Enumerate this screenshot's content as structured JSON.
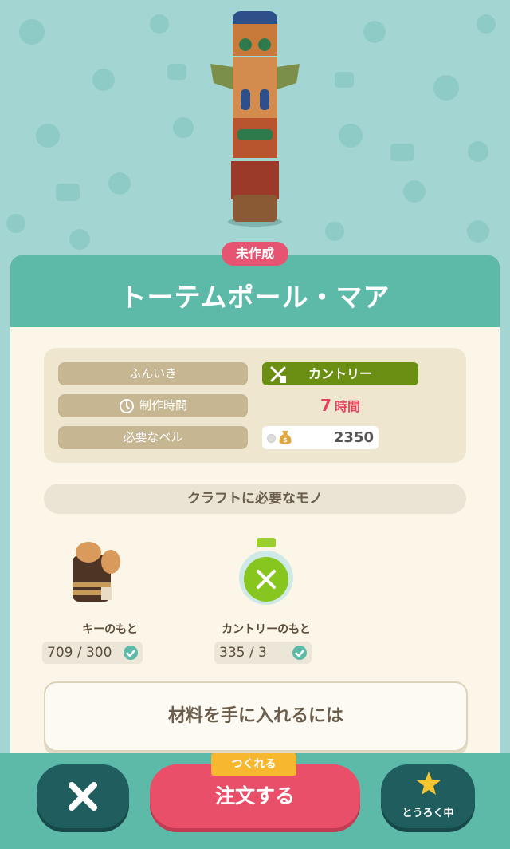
{
  "status_badge": "未作成",
  "item": {
    "name": "トーテムポール・マア"
  },
  "info": {
    "style_label": "ふんいき",
    "style_value": "カントリー",
    "time_label": "制作時間",
    "time_number": "7",
    "time_unit": "時間",
    "bells_label": "必要なベル",
    "bells_value": "2350"
  },
  "craft_header": "クラフトに必要なモノ",
  "materials": [
    {
      "name": "キーのもと",
      "count": "709 / 300",
      "icon": "wood-bundle-icon"
    },
    {
      "name": "カントリーのもと",
      "count": "335 / 3",
      "icon": "green-potion-icon"
    }
  ],
  "get_materials_label": "材料を手に入れるには",
  "actions": {
    "craftable_tag": "つくれる",
    "order_label": "注文する",
    "favorite_label": "とうろく中"
  },
  "colors": {
    "accent": "#5dbaa9",
    "cta": "#ea4f69",
    "dark_button": "#1f5d5e",
    "badge": "#e55471",
    "style_green": "#6b8f12",
    "star": "#f7c52e"
  }
}
